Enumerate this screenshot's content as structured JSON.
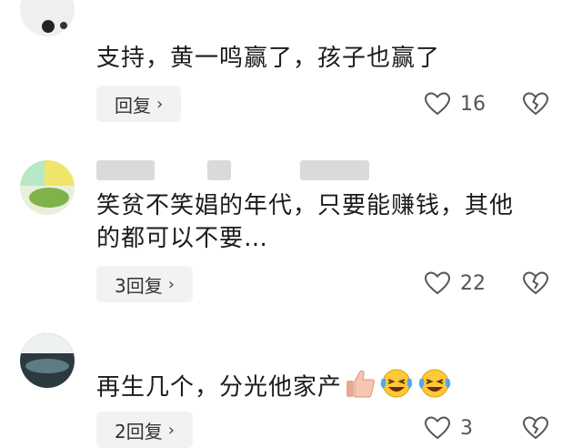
{
  "comments": [
    {
      "text": "支持，黄一鸣赢了，孩子也赢了",
      "reply_label": "回复",
      "likes": "16"
    },
    {
      "text_line1": "笑贫不笑娼的年代，只要能赚钱，其他",
      "text_line2": "的都可以不要…",
      "reply_label": "3回复",
      "likes": "22"
    },
    {
      "text": "再生几个，分光他家产",
      "reply_label": "2回复",
      "likes": "3"
    }
  ],
  "icons": {
    "like": "heart-outline-icon",
    "dislike": "broken-heart-icon",
    "chevron": "chevron-right-icon",
    "emoji_1": "thumbs-up-emoji",
    "emoji_2": "laughing-crying-emoji"
  },
  "colors": {
    "reply_bg": "#f2f2f2",
    "text": "#1b1b1b",
    "meta": "#555555"
  }
}
